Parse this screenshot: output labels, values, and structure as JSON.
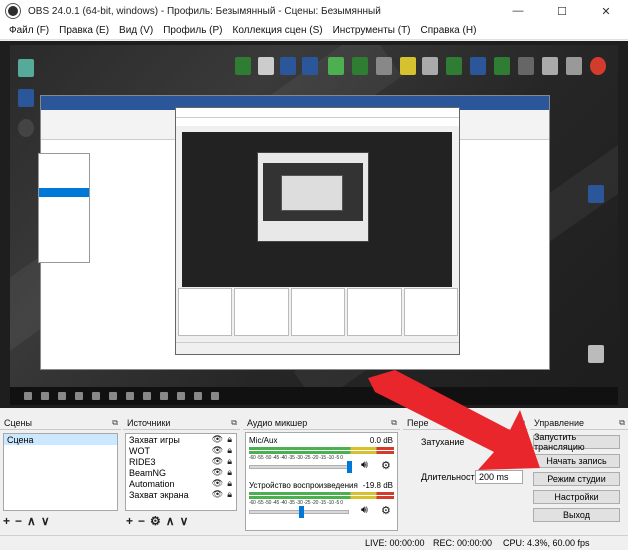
{
  "window": {
    "title": "OBS 24.0.1 (64-bit, windows) - Профиль: Безымянный - Сцены: Безымянный",
    "minimize": "—",
    "maximize": "☐",
    "close": "✕"
  },
  "menu": [
    "Файл (F)",
    "Правка (E)",
    "Вид (V)",
    "Профиль (P)",
    "Коллекция сцен (S)",
    "Инструменты (T)",
    "Справка (H)"
  ],
  "docks": {
    "scenes": {
      "title": "Сцены",
      "items": [
        "Сцена"
      ]
    },
    "sources": {
      "title": "Источники",
      "items": [
        "Захват игры",
        "WOT",
        "RIDE3",
        "BeamNG",
        "Automation",
        "Захват экрана"
      ]
    },
    "mixer": {
      "title": "Аудио микшер",
      "channels": [
        {
          "name": "Mic/Aux",
          "db": "0.0 dB"
        },
        {
          "name": "Устройство воспроизведения",
          "db": "-19.8 dB"
        }
      ],
      "scale": "-60 -55 -50 -45 -40 -35 -30 -25 -20 -15 -10 -5 0"
    },
    "transitions": {
      "title": "Пере",
      "fade_label": "Затухание",
      "duration_label": "Длительность",
      "duration_value": "200 ms"
    },
    "controls": {
      "title": "Управление",
      "buttons": [
        "Запустить трансляцию",
        "Начать запись",
        "Режим студии",
        "Настройки",
        "Выход"
      ]
    }
  },
  "status": {
    "live": "LIVE: 00:00:00",
    "rec": "REC: 00:00:00",
    "cpu": "CPU: 4.3%, 60.00 fps"
  },
  "colors": {
    "accent": "#0078d7",
    "arrow": "#e8262b",
    "meter_green": "#4caf50",
    "meter_yellow": "#d6c22e",
    "meter_red": "#d33c2c"
  }
}
